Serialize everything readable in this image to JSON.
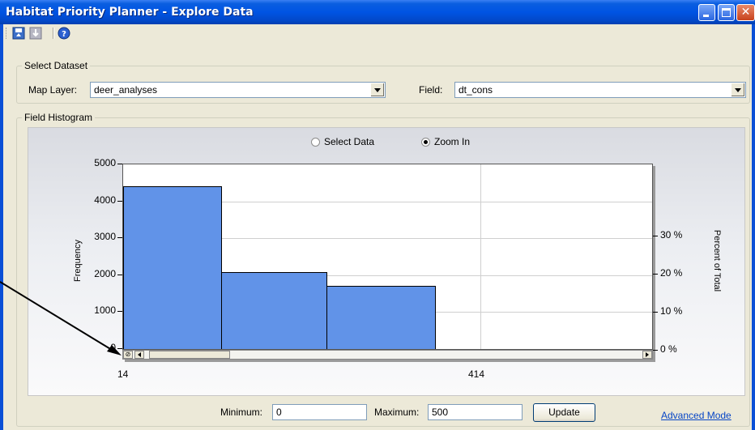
{
  "window": {
    "title": "Habitat Priority Planner - Explore Data",
    "controls": [
      "minimize",
      "maximize",
      "close"
    ]
  },
  "toolbar": {
    "icons": [
      "save-icon",
      "export-icon",
      "help-icon"
    ]
  },
  "select_dataset": {
    "group_label": "Select Dataset",
    "map_layer_label": "Map Layer:",
    "map_layer_value": "deer_analyses",
    "field_label": "Field:",
    "field_value": "dt_cons"
  },
  "histogram": {
    "group_label": "Field Histogram",
    "mode_options": [
      {
        "label": "Select Data",
        "selected": false
      },
      {
        "label": "Zoom In",
        "selected": true
      }
    ],
    "y_axis_label": "Frequency",
    "y2_axis_label": "Percent of Total",
    "x_tick_labels": [
      "14",
      "414"
    ]
  },
  "chart_data": {
    "type": "bar",
    "title": "",
    "xlabel": "",
    "ylabel": "Frequency",
    "y2label": "Percent of Total",
    "ylim": [
      0,
      5000
    ],
    "yticks": [
      "0",
      "1000",
      "2000",
      "3000",
      "4000",
      "5000"
    ],
    "y2ticks": [
      "0 %",
      "10 %",
      "20 %",
      "30 %"
    ],
    "xticks": [
      "14",
      "414"
    ],
    "bins": [
      {
        "start": 14,
        "end": 124,
        "value": 4400
      },
      {
        "start": 124,
        "end": 242,
        "value": 2080
      },
      {
        "start": 242,
        "end": 363,
        "value": 1720
      }
    ],
    "grid": true
  },
  "range": {
    "minimum_label": "Minimum:",
    "minimum_value": "0",
    "maximum_label": "Maximum:",
    "maximum_value": "500",
    "update_label": "Update",
    "advanced_label": "Advanced Mode"
  }
}
